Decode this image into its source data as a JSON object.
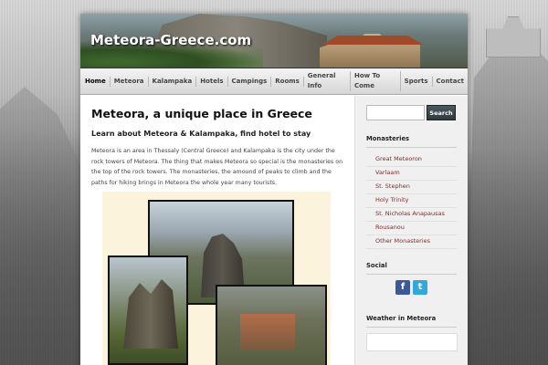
{
  "site": {
    "title": "Meteora-Greece.com"
  },
  "nav": {
    "items": [
      "Home",
      "Meteora",
      "Kalampaka",
      "Hotels",
      "Campings",
      "Rooms",
      "General Info",
      "How To Come",
      "Sports",
      "Contact"
    ]
  },
  "post": {
    "title": "Meteora, a unique place in Greece",
    "subtitle": "Learn about Meteora & Kalampaka, find hotel to stay",
    "body": "Meteora is an area in Thessaly (Central Greece) and Kalampaka is the city under the rock towers of Meteora. The thing that makes Meteora so special is the monasteries on the top of the rock towers. The monasteries, the amound of peaks to climb and the paths for hiking brings in Meteora  the whole year many tourists."
  },
  "sidebar": {
    "search_button": "Search",
    "search_value": "",
    "monasteries_title": "Monasteries",
    "monasteries": [
      "Great Meteoron",
      "Varlaam",
      "St. Stephen",
      "Holy Trinity",
      "St. Nicholas Anapausas",
      "Rousanou",
      "Other Monasteries"
    ],
    "social_title": "Social",
    "weather_title": "Weather in Meteora"
  },
  "colors": {
    "link": "#7a2e2e",
    "search_button": "#3a4a4c",
    "facebook": "#3b5998",
    "twitter": "#33a8da"
  },
  "icons": {
    "facebook": "facebook-icon",
    "twitter": "twitter-icon"
  }
}
